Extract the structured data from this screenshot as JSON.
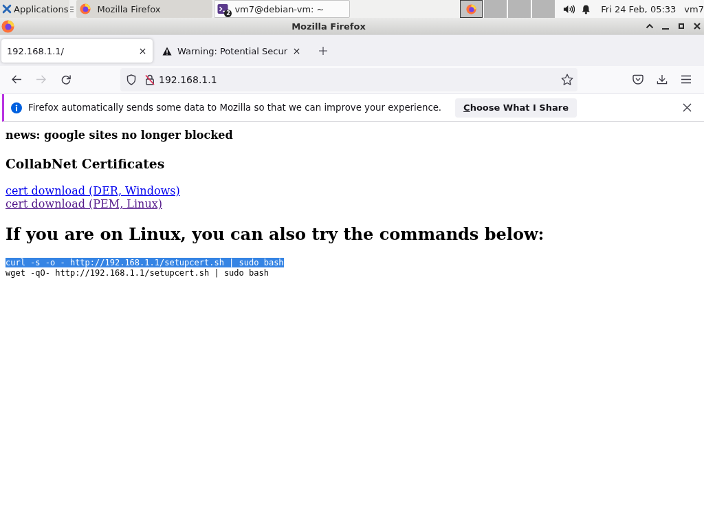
{
  "taskbar": {
    "apps_menu": {
      "label": "Applications"
    },
    "tasks": [
      {
        "label": "Mozilla Firefox",
        "kind": "browser",
        "selected": true,
        "hovered": false
      },
      {
        "label": "vm7@debian-vm: ~",
        "kind": "terminal",
        "badge": "2",
        "selected": false,
        "hovered": true
      }
    ],
    "workspaces": [
      {
        "selected": true,
        "occupied": true
      },
      {
        "selected": false,
        "occupied": false
      },
      {
        "selected": false,
        "occupied": false
      },
      {
        "selected": false,
        "occupied": false
      }
    ],
    "clock": "Fri 24 Feb, 05:33",
    "user": "vm7"
  },
  "window": {
    "title": "Mozilla Firefox"
  },
  "tabs": [
    {
      "title": "192.168.1.1/",
      "kind": "page",
      "selected": true
    },
    {
      "title": "Warning: Potential Secur",
      "kind": "warning",
      "selected": false
    }
  ],
  "toolbar": {
    "back": {
      "disabled": false
    },
    "forward": {
      "disabled": true
    },
    "address": "192.168.1.1"
  },
  "notification": {
    "message": "Firefox automatically sends some data to Mozilla so that we can improve your experience.",
    "button": "Choose What I Share"
  },
  "page": {
    "news": "news: google sites no longer blocked",
    "heading": "CollabNet Certificates",
    "links": [
      {
        "text": "cert download (DER, Windows)",
        "visited": false
      },
      {
        "text": "cert download (PEM, Linux)",
        "visited": true
      }
    ],
    "commands_heading": "If you are on Linux, you can also try the commands below:",
    "commands": [
      {
        "text": "curl -s -o - http://192.168.1.1/setupcert.sh | sudo bash",
        "selected": true
      },
      {
        "text": "wget -qO- http://192.168.1.1/setupcert.sh | sudo bash",
        "selected": false
      }
    ]
  }
}
